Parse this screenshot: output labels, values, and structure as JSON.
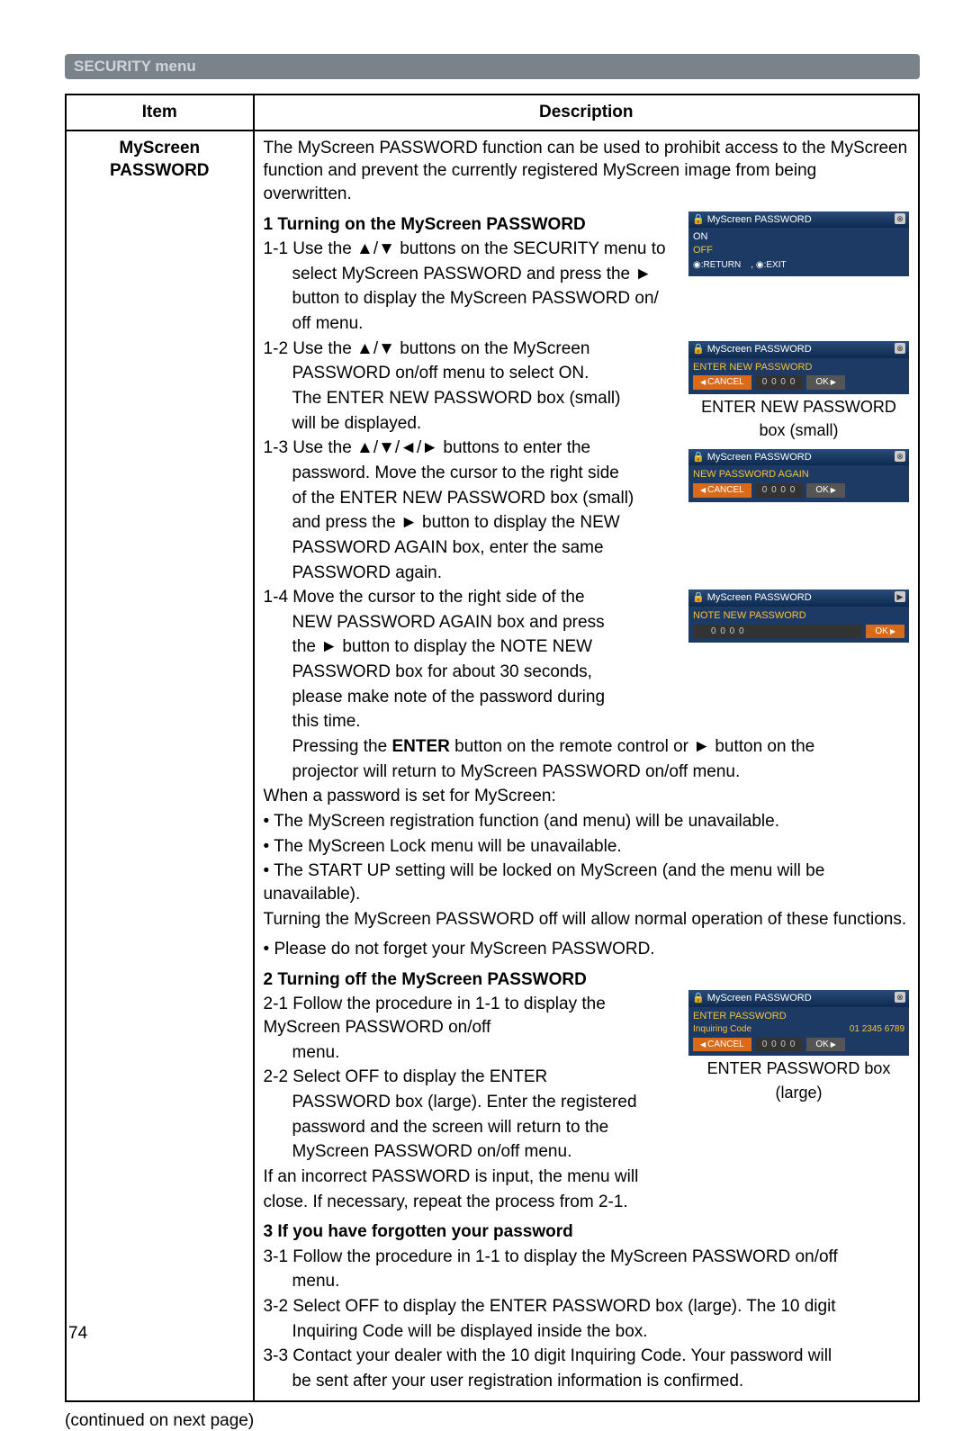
{
  "banner": "SECURITY menu",
  "headers": {
    "item": "Item",
    "desc": "Description"
  },
  "item_label_l1": "MyScreen",
  "item_label_l2": "PASSWORD",
  "intro": "The MyScreen PASSWORD function can be used to prohibit access to the MyScreen function and prevent the currently registered MyScreen image from being overwritten.",
  "s1": {
    "head": "1 Turning on the MyScreen PASSWORD",
    "p11a": "1-1 Use the ▲/▼ buttons on the SECURITY menu to",
    "p11b": "select MyScreen PASSWORD and press the ►",
    "p11c": "button to display the MyScreen PASSWORD on/",
    "p11d": "off menu.",
    "p12a": "1-2 Use the ▲/▼ buttons on the MyScreen",
    "p12b": "PASSWORD on/off menu to select ON.",
    "p12c": "The ENTER NEW PASSWORD box (small)",
    "p12d": "will be displayed.",
    "p13a": "1-3 Use the ▲/▼/◄/► buttons to enter the",
    "p13b": "password. Move the cursor to the right side",
    "p13c": "of the ENTER NEW PASSWORD box (small)",
    "p13d": "and press the ► button to display the NEW",
    "p13e": "PASSWORD AGAIN box, enter the same",
    "p13f": "PASSWORD again.",
    "p14a": "1-4 Move the cursor to the right side of the",
    "p14b": "NEW PASSWORD AGAIN box and press",
    "p14c": "the ► button to display the NOTE NEW",
    "p14d": "PASSWORD box for about 30 seconds,",
    "p14e": "please make note of the password during",
    "p14f": "this time.",
    "tail1a": "Pressing the ",
    "tail1b": "ENTER",
    "tail1c": " button on the remote control or ► button on the",
    "tail2": "projector will return to MyScreen PASSWORD on/off menu.",
    "when": "When a password is set for MyScreen:",
    "b1": "• The MyScreen registration function (and menu) will be unavailable.",
    "b2": "• The MyScreen Lock menu will be unavailable.",
    "b3": "• The START UP setting will be locked on MyScreen (and the menu will be unavailable).",
    "turnoff": "Turning the MyScreen PASSWORD off will allow normal operation of these functions.",
    "note": "• Please do not forget your MyScreen PASSWORD."
  },
  "s2": {
    "head": "2 Turning off the MyScreen PASSWORD",
    "p21a": "2-1 Follow the procedure in 1-1 to display the MyScreen PASSWORD on/off",
    "p21b": "menu.",
    "p22a": "2-2 Select OFF to display the ENTER",
    "p22b": "PASSWORD box (large). Enter the registered",
    "p22c": "password and the screen will return to the",
    "p22d": "MyScreen PASSWORD on/off menu.",
    "tail1": "If an incorrect PASSWORD is input, the menu will",
    "tail2": "close. If necessary, repeat the process from 2-1."
  },
  "s3": {
    "head": "3 If you have forgotten your password",
    "p31": "3-1 Follow the procedure in 1-1 to display the MyScreen PASSWORD on/off",
    "p31b": "menu.",
    "p32": "3-2 Select OFF to display the ENTER PASSWORD box (large). The 10 digit",
    "p32b": "Inquiring Code will be displayed inside the box.",
    "p33": "3-3 Contact your dealer with the 10 digit Inquiring Code. Your password will",
    "p33b": "be sent after your user registration information is confirmed."
  },
  "panels": {
    "title": "MyScreen PASSWORD",
    "on": "ON",
    "off": "OFF",
    "ret": "◉:RETURN",
    "exit": ", ◉:EXIT",
    "enter_new": "ENTER NEW PASSWORD",
    "new_again": "NEW PASSWORD AGAIN",
    "note_new": "NOTE NEW PASSWORD",
    "enter_pw": "ENTER PASSWORD",
    "inq_label": "Inquiring Code",
    "inq_code": "01 2345 6789",
    "cancel": "CANCEL",
    "code": "0 0 0 0",
    "ok": "OK",
    "cap1a": "ENTER NEW PASSWORD",
    "cap1b": "box (small)",
    "cap2a": "ENTER PASSWORD box",
    "cap2b": "(large)"
  },
  "cont": "(continued on next page)",
  "page_no": "74"
}
